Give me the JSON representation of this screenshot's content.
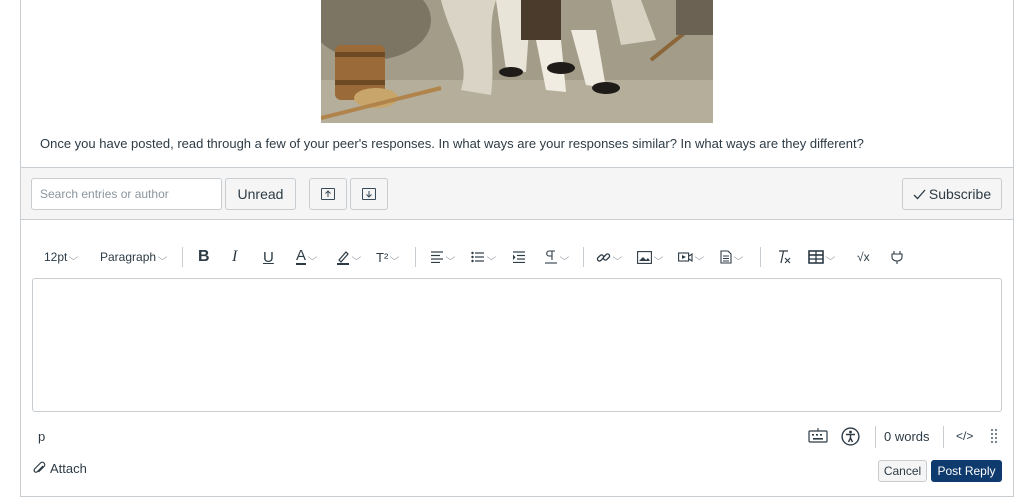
{
  "post": {
    "prompt_text": "Once you have posted, read through a few of your peer's responses. In what ways are your responses similar? In what ways are they different?"
  },
  "discussion_toolbar": {
    "search_placeholder": "Search entries or author",
    "unread_label": "Unread",
    "subscribe_label": "Subscribe"
  },
  "editor": {
    "font_size": "12pt",
    "block_format": "Paragraph",
    "bold_glyph": "B",
    "italic_glyph": "I",
    "underline_glyph": "U",
    "text_color_glyph": "A",
    "superscript_glyph": "T²",
    "formula_glyph": "√x",
    "element_path": "p",
    "word_count": "0 words",
    "html_toggle": "</>"
  },
  "actions": {
    "attach_label": "Attach",
    "cancel_label": "Cancel",
    "post_reply_label": "Post Reply"
  },
  "colors": {
    "primary_button": "#0e3a6e",
    "border": "#c7cdd1",
    "toolbar_bg": "#f5f5f5",
    "text": "#2d3b45"
  }
}
